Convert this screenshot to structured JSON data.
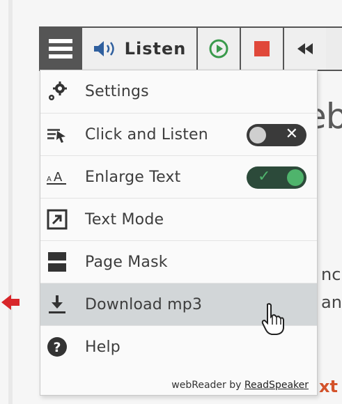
{
  "toolbar": {
    "listen_label": "Listen",
    "buttons": [
      "menu-icon",
      "speaker-icon",
      "play-icon",
      "stop-icon",
      "rewind-icon"
    ]
  },
  "menu": {
    "items": [
      {
        "label": "Settings",
        "icon": "gear-icon"
      },
      {
        "label": "Click and Listen",
        "icon": "click-listen-icon",
        "toggle": "off"
      },
      {
        "label": "Enlarge Text",
        "icon": "enlarge-text-icon",
        "toggle": "on"
      },
      {
        "label": "Text Mode",
        "icon": "text-mode-icon"
      },
      {
        "label": "Page Mask",
        "icon": "page-mask-icon"
      },
      {
        "label": "Download mp3",
        "icon": "download-icon",
        "hovered": true
      },
      {
        "label": "Help",
        "icon": "help-icon"
      }
    ],
    "footer_prefix": "webReader by ",
    "footer_brand": "ReadSpeaker"
  },
  "background": {
    "heading_fragment": "eb",
    "line1_fragment": "nc",
    "line2_fragment": "an",
    "line3_fragment": "xt"
  },
  "colors": {
    "toolbar_border": "#555555",
    "toggle_on": "#4fb46c",
    "stop_red": "#e0483a",
    "hover_bg": "#d2d6d8",
    "pointer_red": "#d8262a"
  }
}
